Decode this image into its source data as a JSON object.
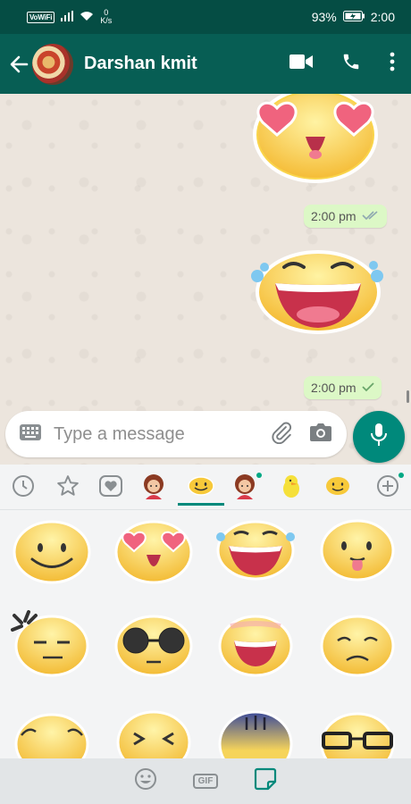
{
  "status_bar": {
    "vowifi": "VoWiFi",
    "net_speed_value": "0",
    "net_speed_unit": "K/s",
    "battery": "93%",
    "time": "2:00"
  },
  "header": {
    "contact_name": "Darshan kmit",
    "icons": [
      "back-arrow-icon",
      "video-call-icon",
      "voice-call-icon",
      "more-options-icon"
    ]
  },
  "messages": [
    {
      "type": "sticker",
      "sticker": "heart-eyes-face",
      "time": "2:00 pm",
      "status": "double-check-read"
    },
    {
      "type": "sticker",
      "sticker": "laughing-tears-face",
      "time": "2:00 pm",
      "status": "single-check-sent"
    }
  ],
  "composer": {
    "placeholder": "Type a message"
  },
  "sticker_tabs": {
    "items": [
      "recent-clock-icon",
      "favorite-star-icon",
      "heart-icon",
      "girl-sticker-pack",
      "smiley-sticker-pack",
      "girl-sticker-pack-2",
      "bird-sticker-pack",
      "smiley-sticker-pack-2",
      "add-icon"
    ],
    "selected": "smiley-sticker-pack"
  },
  "bottom_bar": {
    "gif_label": "GIF",
    "selected": "sticker"
  },
  "colors": {
    "header": "#075e54",
    "status_bar": "#054d44",
    "accent": "#00897b",
    "outgoing_bubble": "#dcf8c6",
    "read_tick": "#4fc3f7"
  }
}
